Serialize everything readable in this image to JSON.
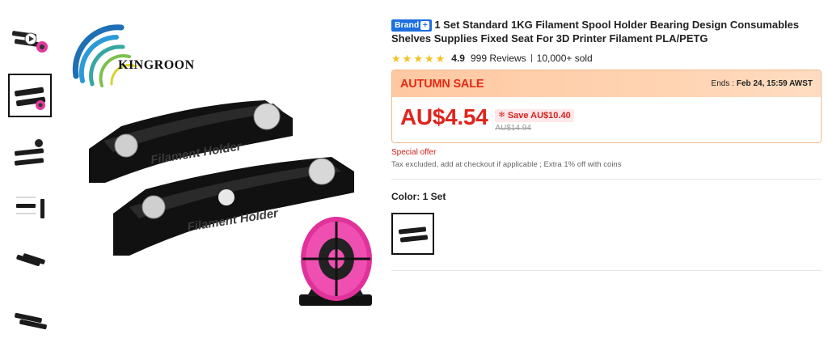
{
  "logo": {
    "name": "KINGROON"
  },
  "product": {
    "brand_badge": "Brand",
    "title": "1 Set Standard 1KG Filament Spool Holder Bearing Design Consumables Shelves Supplies Fixed Seat For 3D Printer Filament PLA/PETG",
    "rating": "4.9",
    "reviews": "999 Reviews",
    "sold": "10,000+ sold",
    "star_count": 5
  },
  "sale": {
    "label": "AUTUMN SALE",
    "ends_prefix": "Ends :",
    "ends_time": "Feb 24, 15:59 AWST",
    "price": "AU$4.54",
    "save": "Save AU$10.40",
    "original_price": "AU$14.94"
  },
  "offers": {
    "special": "Special offer",
    "tax_note": "Tax excluded, add at checkout if applicable ; Extra 1% off with coins"
  },
  "color": {
    "label": "Color: 1 Set"
  },
  "main_image": {
    "embossed_text": "Filament Holder"
  },
  "colors": {
    "accent_red": "#e0241d",
    "brand_blue": "#1d6fe0",
    "star": "#f4c21e"
  },
  "thumbnails": [
    {
      "name": "thumb-video",
      "icon": "play-icon"
    },
    {
      "name": "thumb-holders-selected"
    },
    {
      "name": "thumb-holders-side"
    },
    {
      "name": "thumb-holders-dimension"
    },
    {
      "name": "thumb-holders-angle"
    },
    {
      "name": "thumb-holders-pair"
    }
  ]
}
